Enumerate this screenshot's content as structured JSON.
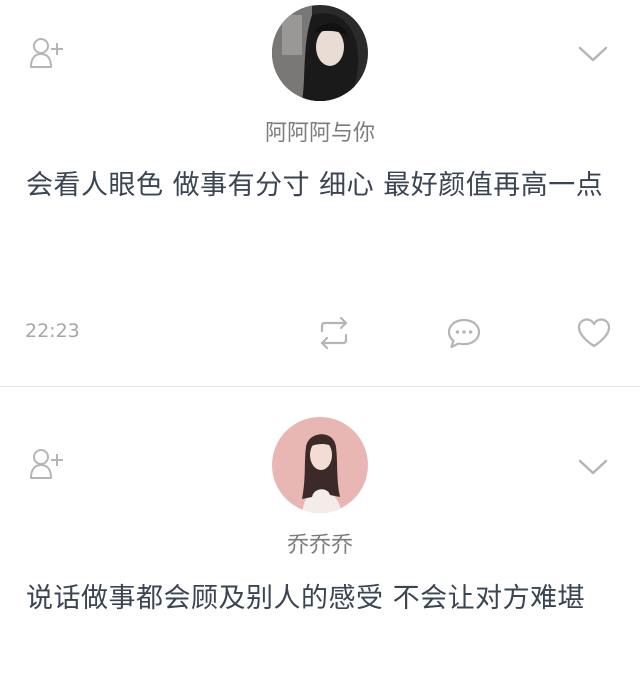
{
  "posts": [
    {
      "username": "阿阿阿与你",
      "content": "会看人眼色 做事有分寸 细心 最好颜值再高一点",
      "time": "22:23",
      "actions": {
        "follow": "follow-icon",
        "menu": "chevron-down-icon",
        "repost": "repost-icon",
        "comment": "comment-icon",
        "like": "heart-icon"
      }
    },
    {
      "username": "乔乔乔",
      "content": "说话做事都会顾及别人的感受 不会让对方难堪",
      "actions": {
        "follow": "follow-icon",
        "menu": "chevron-down-icon"
      }
    }
  ],
  "colors": {
    "icon_gray": "#b5b5b5",
    "text_main": "#3b4452",
    "text_meta": "#a6a6a6",
    "username": "#7c7c7c",
    "divider": "#e3e3e3"
  }
}
